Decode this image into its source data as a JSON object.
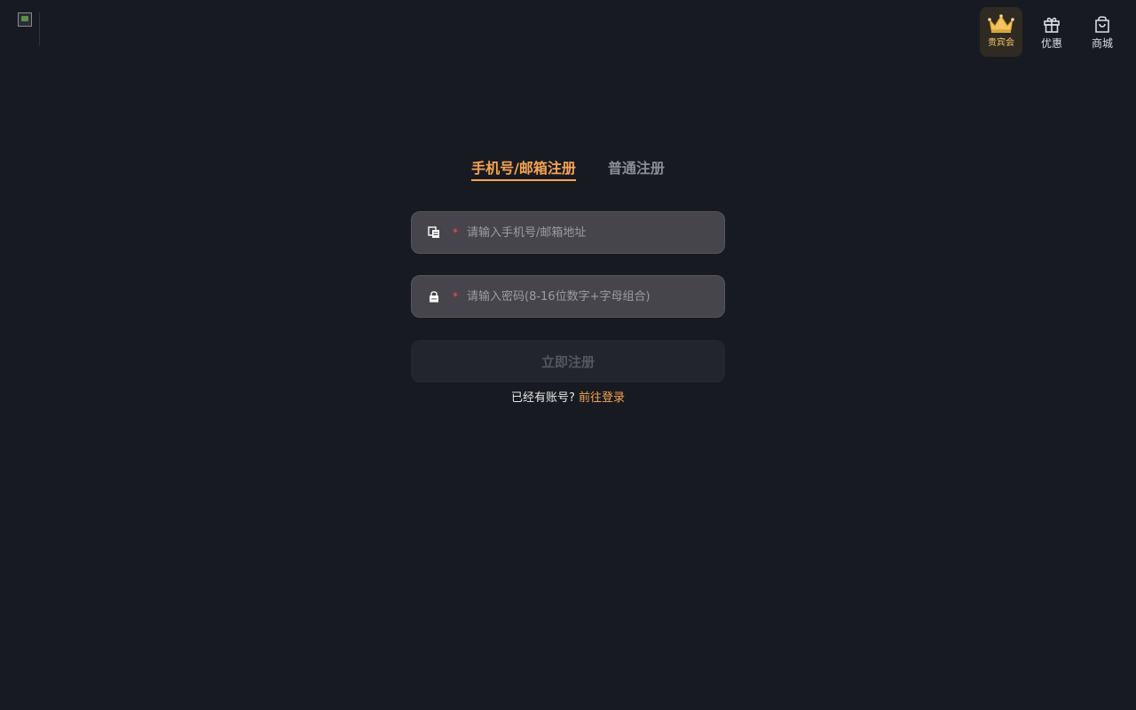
{
  "header": {
    "nav": [
      {
        "label": "贵宾会",
        "icon": "crown-icon"
      },
      {
        "label": "优惠",
        "icon": "gift-icon"
      },
      {
        "label": "商城",
        "icon": "shopping-bag-icon"
      }
    ]
  },
  "tabs": [
    {
      "label": "手机号/邮箱注册",
      "active": true
    },
    {
      "label": "普通注册",
      "active": false
    }
  ],
  "form": {
    "account": {
      "placeholder": "请输入手机号/邮箱地址",
      "value": "",
      "required_mark": "*",
      "icon": "phone-email-icon"
    },
    "password": {
      "placeholder": "请输入密码(8-16位数字+字母组合)",
      "value": "",
      "required_mark": "*",
      "icon": "lock-icon"
    },
    "submit_label": "立即注册",
    "login_prompt": "已经有账号?",
    "login_link": "前往登录"
  },
  "colors": {
    "background": "#181a21",
    "accent": "#f5a452",
    "vip_gold": "#f0c46a",
    "required": "#ff4d4f"
  }
}
